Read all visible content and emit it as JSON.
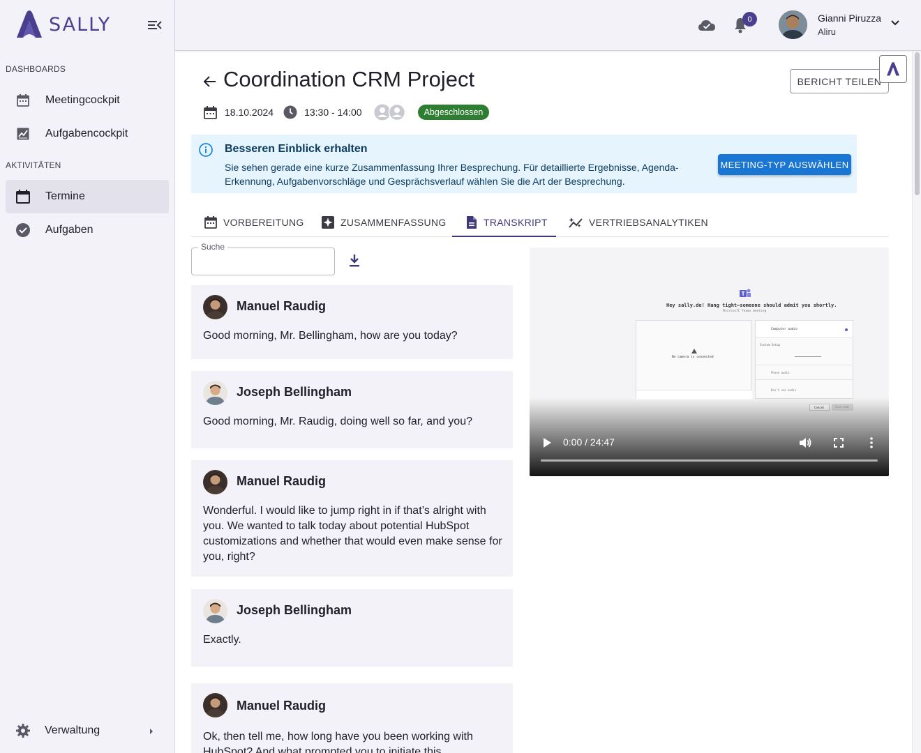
{
  "app": {
    "logo_text": "SALLY"
  },
  "sidebar": {
    "sections": [
      {
        "label": "DASHBOARDS"
      },
      {
        "label": "AKTIVITÄTEN"
      }
    ],
    "items": [
      {
        "label": "Meetingcockpit",
        "icon": "calendar-icon"
      },
      {
        "label": "Aufgabencockpit",
        "icon": "chart-icon"
      },
      {
        "label": "Termine",
        "icon": "calendar-icon",
        "active": true
      },
      {
        "label": "Aufgaben",
        "icon": "check-circle-icon"
      }
    ],
    "footer": {
      "label": "Verwaltung",
      "icon": "gear-icon"
    }
  },
  "topbar": {
    "notifications_count": "0",
    "user": {
      "name": "Gianni Piruzza",
      "org": "Aliru"
    }
  },
  "meeting": {
    "title": "Coordination CRM Project",
    "date": "18.10.2024",
    "time": "13:30 - 14:00",
    "status": "Abgeschlossen",
    "share_label": "BERICHT TEILEN"
  },
  "banner": {
    "title": "Besseren Einblick erhalten",
    "text": "Sie sehen gerade eine kurze Zusammenfassung Ihrer Besprechung. Für detaillierte Ergebnisse, Agenda-Erkennung, Aufgabenvorschläge und Gesprächsverlauf wählen Sie die Art der Besprechung.",
    "button_label": "MEETING-TYP AUSWÄHLEN"
  },
  "tabs": [
    {
      "label": "VORBEREITUNG",
      "icon": "calendar-icon"
    },
    {
      "label": "ZUSAMMENFASSUNG",
      "icon": "sparkle-icon"
    },
    {
      "label": "TRANSKRIPT",
      "icon": "document-icon",
      "active": true
    },
    {
      "label": "VERTRIEBSANALYTIKEN",
      "icon": "analytics-icon"
    }
  ],
  "transcript": {
    "search_label": "Suche",
    "search_value": "",
    "messages": [
      {
        "speaker": "Manuel Raudig",
        "text": "Good morning, Mr. Bellingham, how are you today?"
      },
      {
        "speaker": "Joseph Bellingham",
        "text": "Good morning, Mr. Raudig, doing well so far, and you?"
      },
      {
        "speaker": "Manuel Raudig",
        "text": "Wonderful. I would like to jump right in if that’s alright with you. We wanted to talk today about potential HubSpot customizations and whether that would even make sense for you, right?"
      },
      {
        "speaker": "Joseph Bellingham",
        "text": "Exactly."
      },
      {
        "speaker": "Manuel Raudig",
        "text": "Ok, then tell me, how long have you been working with HubSpot? And what prompted you to initiate this"
      }
    ]
  },
  "video": {
    "time": "0:00 / 24:47",
    "progress": 0,
    "screen": {
      "headline": "Hey sally.de! Hang tight—someone should admit you shortly.",
      "subline": "Microsoft Teams meeting",
      "camera_text": "No camera is connected",
      "computer_audio": "Computer audio",
      "custom_setup": "Custom Setup",
      "phone_audio": "Phone audio",
      "no_audio": "Don't use audio",
      "cancel": "Cancel",
      "join": "Join now"
    }
  },
  "colors": {
    "brand": "#4a3f8f",
    "status_done": "#2e7d32",
    "info_button": "#1976d2",
    "info_bg": "#e5f4fd"
  }
}
